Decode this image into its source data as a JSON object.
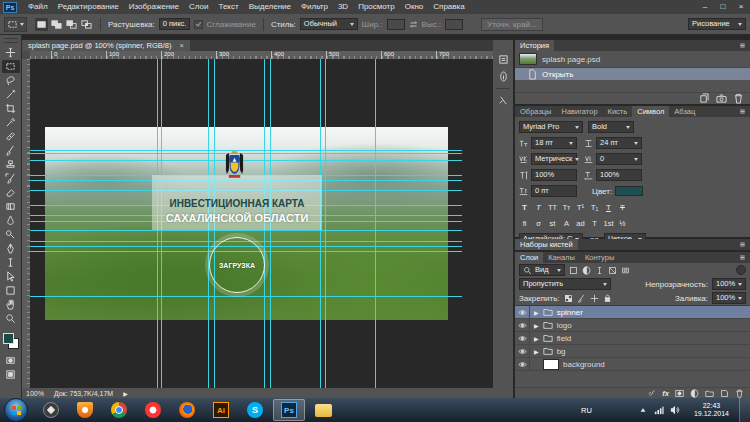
{
  "app": {
    "logo": "Ps"
  },
  "menu": [
    "Файл",
    "Редактирование",
    "Изображение",
    "Слои",
    "Текст",
    "Выделение",
    "Фильтр",
    "3D",
    "Просмотр",
    "Окно",
    "Справка"
  ],
  "window_controls": [
    "–",
    "□",
    "×"
  ],
  "options_bar": {
    "feather_label": "Растушевка:",
    "feather_value": "0 пикс.",
    "antialias_label": "Сглаживание",
    "antialias_checked": true,
    "antialias_disabled": true,
    "style_label": "Стиль:",
    "style_value": "Обычный",
    "width_label": "Шир.:",
    "height_label": "Выс.:",
    "size_disabled": true,
    "refine_button": "Уточн. край...",
    "refine_disabled": true,
    "workspace": "Рисование"
  },
  "toolbar": {
    "tools": [
      {
        "kind": "move",
        "selected": false
      },
      {
        "kind": "marquee",
        "selected": true
      },
      {
        "kind": "lasso",
        "selected": false
      },
      {
        "kind": "wand",
        "selected": false
      },
      {
        "kind": "crop",
        "selected": false
      },
      {
        "kind": "eyedrop",
        "selected": false
      },
      {
        "kind": "heal",
        "selected": false
      },
      {
        "kind": "brush",
        "selected": false
      },
      {
        "kind": "stamp",
        "selected": false
      },
      {
        "kind": "historybrush",
        "selected": false
      },
      {
        "kind": "eraser",
        "selected": false
      },
      {
        "kind": "gradient",
        "selected": false
      },
      {
        "kind": "blur",
        "selected": false
      },
      {
        "kind": "dodge",
        "selected": false
      },
      {
        "kind": "pen",
        "selected": false
      },
      {
        "kind": "type",
        "selected": false
      },
      {
        "kind": "pathselect",
        "selected": false
      },
      {
        "kind": "shape",
        "selected": false
      },
      {
        "kind": "hand",
        "selected": false
      },
      {
        "kind": "zoom",
        "selected": false
      }
    ],
    "foreground": "#1d4a47",
    "background": "#ffffff"
  },
  "document": {
    "tab": "splash page.psd @ 100% (spinner, RGB/8)",
    "close": "×",
    "ruler_marks": [
      "0",
      "100",
      "200",
      "300",
      "400",
      "500",
      "600",
      "700"
    ],
    "zoom": "100%",
    "info": "Док: 753,7K/4,17M",
    "info_arrow": "▶"
  },
  "artboard": {
    "title": "ИНВЕСТИЦИОННАЯ КАРТА",
    "subtitle": "САХАЛИНСКОЙ ОБЛАСТИ",
    "spinner": "ЗАГРУЗКА"
  },
  "history": {
    "tab": "История",
    "snapshot": "splash page.psd",
    "steps": [
      {
        "label": "Открыть",
        "selected": true
      }
    ]
  },
  "character": {
    "tabs": [
      {
        "label": "Образцы",
        "selected": false
      },
      {
        "label": "Навигатор",
        "selected": false
      },
      {
        "label": "Кисть",
        "selected": false
      },
      {
        "label": "Символ",
        "selected": true
      },
      {
        "label": "Абзац",
        "selected": false
      }
    ],
    "font_family": "Myriad Pro",
    "font_style": "Bold",
    "size": "18 пт",
    "leading": "24 пт",
    "kerning": "Метрическ",
    "tracking": "0",
    "vertical_scale": "100%",
    "horizontal_scale": "100%",
    "baseline_shift": "0 пт",
    "color_label": "Цвет:",
    "color": "#1d5050",
    "style_buttons": [
      {
        "glyph": "T",
        "kind": "bold"
      },
      {
        "glyph": "T",
        "kind": "italic"
      },
      {
        "glyph": "TT",
        "kind": "caps"
      },
      {
        "glyph": "Tт",
        "kind": "smallcaps"
      },
      {
        "glyph": "T¹",
        "kind": "super"
      },
      {
        "glyph": "T₁",
        "kind": "sub"
      },
      {
        "glyph": "T",
        "kind": "underline"
      },
      {
        "glyph": "T",
        "kind": "strike"
      }
    ],
    "opentype_buttons": [
      "fi",
      "σ",
      "st",
      "A",
      "ad",
      "T",
      "1st",
      "½"
    ],
    "language": "Английский: С",
    "aa_label": "aa",
    "antialias": "Четкое"
  },
  "brush_presets": {
    "tab": "Наборы кистей"
  },
  "layers": {
    "tabs": [
      {
        "label": "Слои",
        "selected": true
      },
      {
        "label": "Каналы",
        "selected": false
      },
      {
        "label": "Контуры",
        "selected": false
      }
    ],
    "filter": "Вид",
    "blend_mode": "Пропустить",
    "opacity_label": "Непрозрачность:",
    "opacity": "100%",
    "lock_label": "Закрепить:",
    "fill_label": "Заливка:",
    "fill": "100%",
    "items": [
      {
        "name": "spinner",
        "kind": "group",
        "arrow": "▶",
        "visible": true,
        "selected": true
      },
      {
        "name": "logo",
        "kind": "group",
        "arrow": "▶",
        "visible": true,
        "selected": false
      },
      {
        "name": "field",
        "kind": "group",
        "arrow": "▶",
        "visible": true,
        "selected": false
      },
      {
        "name": "bg",
        "kind": "group",
        "arrow": "▶",
        "visible": true,
        "selected": false
      },
      {
        "name": "background",
        "kind": "layer",
        "visible": true,
        "selected": false
      }
    ],
    "footer_fx": "fx"
  },
  "taskbar": {
    "apps": [
      {
        "kind": "unity",
        "active": false
      },
      {
        "kind": "player",
        "active": false
      },
      {
        "kind": "chrome",
        "active": false
      },
      {
        "kind": "yandex",
        "active": false
      },
      {
        "kind": "firefox",
        "active": false
      },
      {
        "kind": "illustrator",
        "glyph": "Ai",
        "active": false
      },
      {
        "kind": "skype",
        "glyph": "S",
        "active": false
      },
      {
        "kind": "photoshop",
        "glyph": "Ps",
        "active": true
      },
      {
        "kind": "explorer",
        "active": false
      }
    ],
    "language": "RU",
    "time": "22:43",
    "date": "19.12.2014"
  }
}
